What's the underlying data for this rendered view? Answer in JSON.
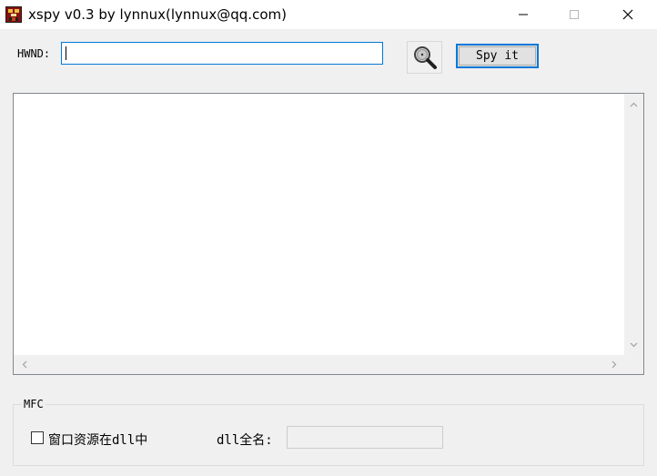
{
  "window": {
    "title": "xspy v0.3 by lynnux(lynnux@qq.com)",
    "controls": {
      "minimize_icon": "minimize-icon",
      "maximize_icon": "maximize-icon",
      "close_icon": "close-icon"
    }
  },
  "hwnd": {
    "label": "HWND:",
    "value": "",
    "finder_icon": "magnifier-icon"
  },
  "spy_button": {
    "label": "Spy it"
  },
  "output": {
    "text": ""
  },
  "mfc": {
    "group_label": "MFC",
    "checkbox_label": "窗口资源在dll中",
    "checkbox_checked": false,
    "dll_fullname_label": "dll全名:",
    "dll_fullname_value": ""
  },
  "colors": {
    "accent": "#0078d7",
    "background": "#f0f0f0"
  }
}
